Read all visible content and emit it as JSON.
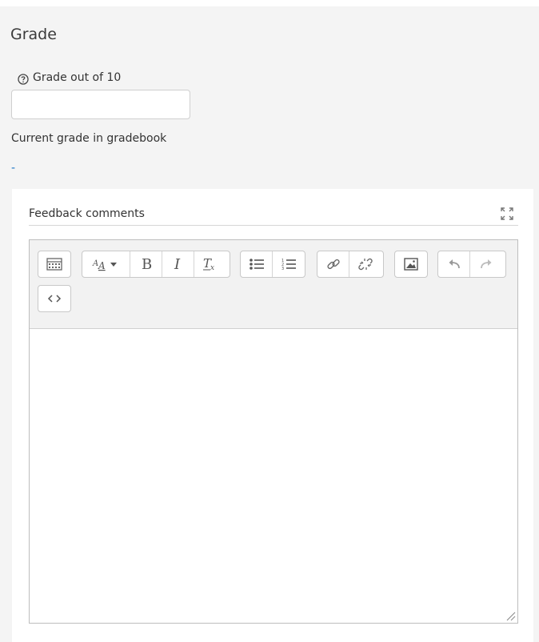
{
  "section": {
    "title": "Grade"
  },
  "grade": {
    "label": "Grade out of 10",
    "input_value": ""
  },
  "current": {
    "label": "Current grade in gradebook",
    "value": "-"
  },
  "feedback": {
    "label": "Feedback comments",
    "toolbar_row1": [
      {
        "group": "toolbar-toggle",
        "buttons": [
          "toolbar-toggle-icon"
        ]
      },
      {
        "group": "text-style",
        "buttons": [
          "font-style-icon",
          "bold-icon",
          "italic-icon",
          "clear-formatting-icon"
        ]
      },
      {
        "group": "lists",
        "buttons": [
          "unordered-list-icon",
          "ordered-list-icon"
        ]
      },
      {
        "group": "links",
        "buttons": [
          "link-icon",
          "unlink-icon"
        ]
      },
      {
        "group": "media",
        "buttons": [
          "image-icon"
        ]
      },
      {
        "group": "history",
        "buttons": [
          "undo-icon",
          "redo-icon"
        ]
      }
    ],
    "toolbar_row2": [
      {
        "group": "html",
        "buttons": [
          "html-source-icon"
        ]
      }
    ],
    "content": ""
  },
  "colors": {
    "panel_bg": "#f4f4f4",
    "link_blue": "#1a73c6",
    "toolbar_bg": "#f2f2f2"
  }
}
